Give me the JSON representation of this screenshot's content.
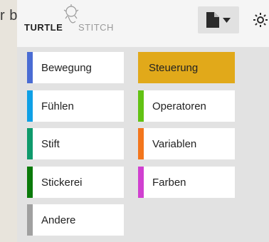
{
  "page": {
    "fragment_text": "r b"
  },
  "header": {
    "logo": {
      "text_left": "TURTLE",
      "text_right": "STITCH"
    },
    "file_icon": "file-icon",
    "dropdown_icon": "caret-down-icon",
    "settings_icon": "gear-icon"
  },
  "categories": [
    {
      "label": "Bewegung",
      "color": "#4a6cd4",
      "selected": false
    },
    {
      "label": "Steuerung",
      "color": "#e1a91a",
      "selected": true
    },
    {
      "label": "Fühlen",
      "color": "#0fa0e6",
      "selected": false
    },
    {
      "label": "Operatoren",
      "color": "#62c213",
      "selected": false
    },
    {
      "label": "Stift",
      "color": "#0e9a6c",
      "selected": false
    },
    {
      "label": "Variablen",
      "color": "#f3761d",
      "selected": false
    },
    {
      "label": "Stickerei",
      "color": "#0a7a0a",
      "selected": false
    },
    {
      "label": "Farben",
      "color": "#d040d0",
      "selected": false
    },
    {
      "label": "Andere",
      "color": "#a0a0a0",
      "selected": false
    }
  ]
}
